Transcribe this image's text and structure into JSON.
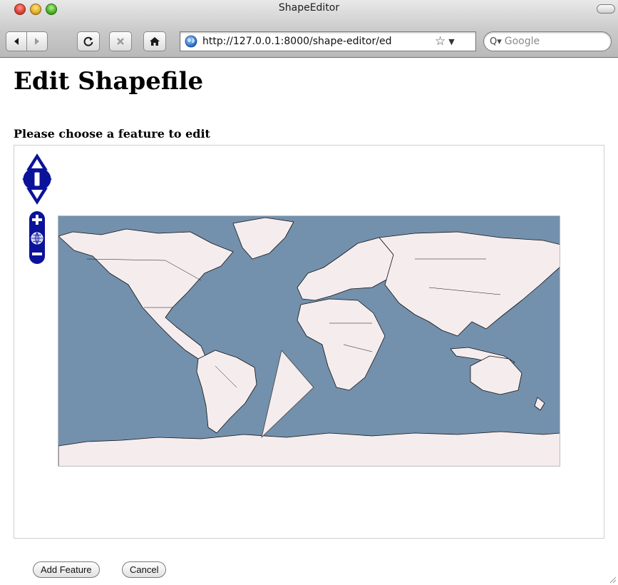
{
  "window": {
    "title": "ShapeEditor"
  },
  "toolbar": {
    "back_icon": "back-arrow-icon",
    "forward_icon": "forward-arrow-icon",
    "reload_icon": "reload-icon",
    "stop_icon": "stop-icon",
    "home_icon": "home-icon",
    "url": "http://127.0.0.1:8000/shape-editor/ed",
    "search_placeholder": "Google"
  },
  "page": {
    "title": "Edit Shapefile",
    "subheading": "Please choose a feature to edit",
    "map": {
      "pan_control": "pan-arrows",
      "zoom_control": "zoom-in-world-zoom-out",
      "ocean_color": "#7391ad",
      "land_color": "#f5ecee"
    },
    "buttons": {
      "add_feature": "Add Feature",
      "cancel": "Cancel"
    }
  }
}
